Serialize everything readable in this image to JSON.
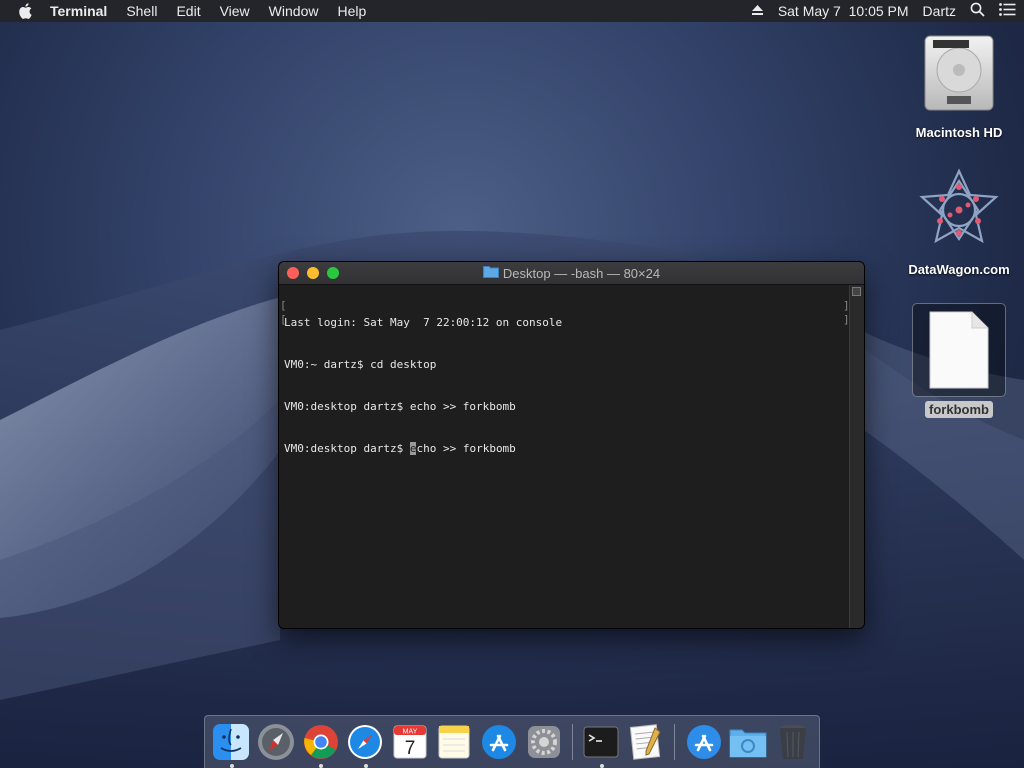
{
  "menubar": {
    "app_name": "Terminal",
    "menus": [
      "Shell",
      "Edit",
      "View",
      "Window",
      "Help"
    ],
    "datetime": "Sat May 7  10:05 PM",
    "user": "Dartz"
  },
  "desktop_icons": [
    {
      "label": "Macintosh HD",
      "icon": "hard-drive-icon"
    },
    {
      "label": "DataWagon.com",
      "icon": "network-volume-icon"
    },
    {
      "label": "forkbomb",
      "icon": "document-icon"
    }
  ],
  "terminal": {
    "title": "Desktop — -bash — 80×24",
    "lines": [
      "Last login: Sat May  7 22:00:12 on console",
      "VM0:~ dartz$ cd desktop",
      "VM0:desktop dartz$ echo >> forkbomb"
    ],
    "prompt": "VM0:desktop dartz$ ",
    "cursor_char": "e",
    "after_cursor": "cho >> forkbomb"
  },
  "dock": {
    "items": [
      {
        "name": "Finder",
        "icon": "finder-icon",
        "running": true
      },
      {
        "name": "Launchpad",
        "icon": "launchpad-icon",
        "running": false
      },
      {
        "name": "Google Chrome",
        "icon": "chrome-icon",
        "running": true
      },
      {
        "name": "Safari",
        "icon": "safari-icon",
        "running": true
      },
      {
        "name": "Calendar",
        "icon": "calendar-icon",
        "running": false,
        "month": "MAY",
        "day": "7"
      },
      {
        "name": "Notes",
        "icon": "notes-icon",
        "running": false
      },
      {
        "name": "App Store",
        "icon": "app-store-icon",
        "running": false
      },
      {
        "name": "System Preferences",
        "icon": "system-preferences-icon",
        "running": false
      },
      {
        "name": "Terminal",
        "icon": "terminal-icon",
        "running": true
      },
      {
        "name": "TextEdit",
        "icon": "textedit-icon",
        "running": false
      },
      {
        "name": "Applications",
        "icon": "applications-folder-icon",
        "running": false
      },
      {
        "name": "Downloads",
        "icon": "downloads-folder-icon",
        "running": false
      },
      {
        "name": "Trash",
        "icon": "trash-icon",
        "running": false
      }
    ]
  }
}
